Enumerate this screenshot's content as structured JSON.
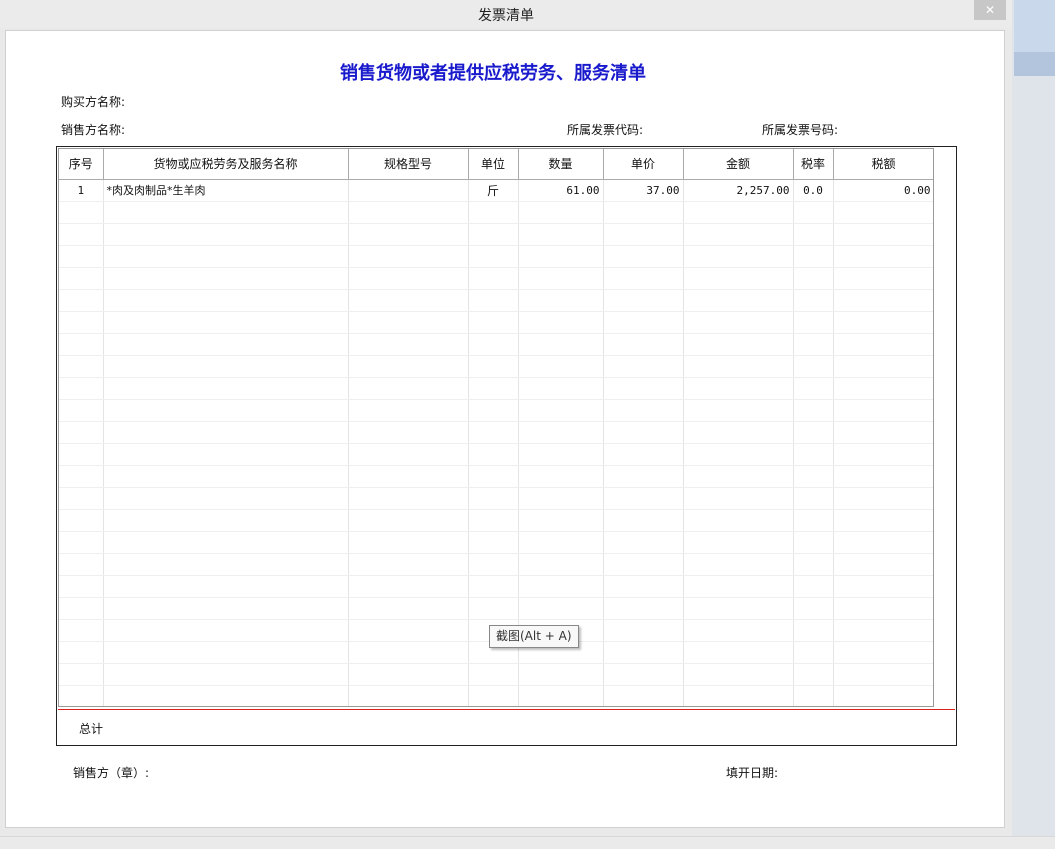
{
  "window": {
    "title": "发票清单",
    "close_label": "✕"
  },
  "document": {
    "title": "销售货物或者提供应税劳务、服务清单",
    "buyer_name_label": "购买方名称:",
    "seller_name_label": "销售方名称:",
    "invoice_code_label": "所属发票代码:",
    "invoice_number_label": "所属发票号码:",
    "seller_seal_label": "销售方（章）:",
    "issue_date_label": "填开日期:",
    "total_label": "总计"
  },
  "table": {
    "columns": [
      "序号",
      "货物或应税劳务及服务名称",
      "规格型号",
      "单位",
      "数量",
      "单价",
      "金额",
      "税率",
      "税额"
    ],
    "rows": [
      {
        "index": "1",
        "name": "*肉及肉制品*生羊肉",
        "spec": "",
        "unit": "斤",
        "quantity": "61.00",
        "unit_price": "37.00",
        "amount": "2,257.00",
        "tax_rate": "0.0",
        "tax": "0.00"
      }
    ]
  },
  "tooltip": {
    "text": "截图(Alt + A)"
  }
}
